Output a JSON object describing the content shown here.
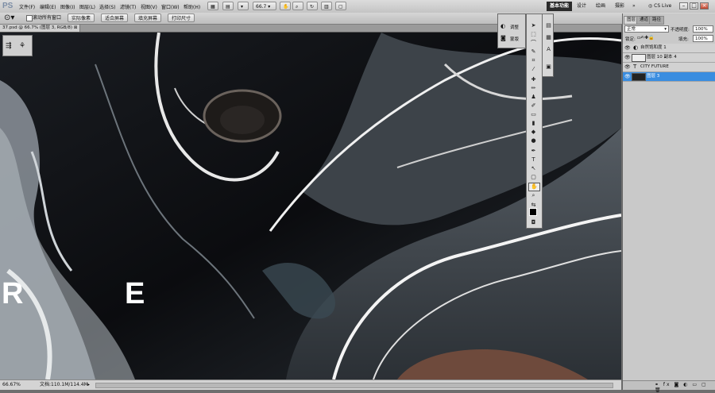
{
  "app": {
    "logo": "PS"
  },
  "menubar": {
    "items": [
      "文件(F)",
      "编辑(E)",
      "图像(I)",
      "图层(L)",
      "选择(S)",
      "滤镜(T)",
      "视图(V)",
      "窗口(W)",
      "帮助(H)"
    ],
    "zoom_value": "66.7",
    "workspaces": [
      "基本功能",
      "设计",
      "绘画",
      "摄影"
    ],
    "more": "»",
    "cs_live": "CS Live"
  },
  "options": {
    "scroll_all_label": "滚动所有窗口",
    "buttons": [
      "实际像素",
      "适合屏幕",
      "填充屏幕",
      "打印尺寸"
    ]
  },
  "document": {
    "tab_title": "37.psd @ 66.7% (图层 3, RGB/8)",
    "canvas_letters": [
      "R",
      "E"
    ]
  },
  "status": {
    "zoom": "66.67%",
    "doc_info": "文档:110.1M/114.4M"
  },
  "adjust_panel": {
    "items": [
      "调整",
      "蒙版"
    ]
  },
  "layers_panel": {
    "tabs": [
      "图层",
      "通道",
      "路径"
    ],
    "blend_mode": "正常",
    "opacity_label": "不透明度:",
    "opacity_value": "100%",
    "lock_label": "锁定:",
    "fill_label": "填充:",
    "fill_value": "100%",
    "layers": [
      {
        "name": "自然饱和度 1",
        "selected": false
      },
      {
        "name": "图层 10 副本 4",
        "selected": false
      },
      {
        "name": "CITY FUTURE",
        "selected": false
      },
      {
        "name": "图层 3",
        "selected": true
      }
    ]
  },
  "colors": {
    "accent": "#3a8de0",
    "chrome": "#c9c9c9",
    "canvas": "#0d0f12"
  }
}
